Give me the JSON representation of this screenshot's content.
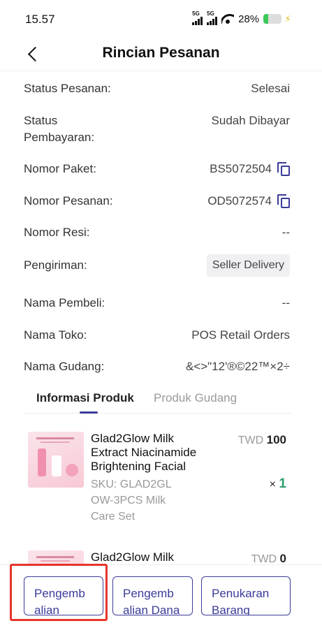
{
  "status_bar": {
    "time": "15.57",
    "signal1_label": "5G",
    "signal2_label": "5G",
    "battery_text": "28%",
    "battery_level": 0.28
  },
  "header": {
    "title": "Rincian Pesanan"
  },
  "details": {
    "status_pesanan": {
      "label": "Status Pesanan:",
      "value": "Selesai"
    },
    "status_pembayaran": {
      "label_line1": "Status",
      "label_line2": "Pembayaran:",
      "value": "Sudah Dibayar"
    },
    "nomor_paket": {
      "label": "Nomor Paket:",
      "value": "BS5072504"
    },
    "nomor_pesanan": {
      "label": "Nomor Pesanan:",
      "value": "OD5072574"
    },
    "nomor_resi": {
      "label": "Nomor Resi:",
      "value": "--"
    },
    "pengiriman": {
      "label": "Pengiriman:",
      "value": "Seller Delivery"
    },
    "nama_pembeli": {
      "label": "Nama Pembeli:",
      "value": "--"
    },
    "nama_toko": {
      "label": "Nama Toko:",
      "value": "POS Retail Orders"
    },
    "nama_gudang": {
      "label": "Nama Gudang:",
      "value": "&<>\"12'®©22™×2÷"
    }
  },
  "tabs": [
    {
      "label": "Informasi Produk",
      "active": true
    },
    {
      "label": "Produk Gudang",
      "active": false
    }
  ],
  "products": [
    {
      "name_line1": "Glad2Glow Milk",
      "name_line2": "Extract Niacinamide",
      "name_line3": "Brightening Facial",
      "sku_line1": "SKU: GLAD2GL",
      "sku_line2": "OW-3PCS Milk",
      "sku_line3": "Care Set",
      "currency": "TWD",
      "price": "100",
      "qty_prefix": "×",
      "qty": "1"
    },
    {
      "name_line1": "Glad2Glow Milk",
      "currency": "TWD",
      "price": "0"
    }
  ],
  "actions": {
    "btn1": {
      "line1": "Pengemb",
      "line2": "alian"
    },
    "btn2": {
      "line1": "Pengemb",
      "line2": "alian Dana"
    },
    "btn3": {
      "line1": "Penukaran",
      "line2": "Barang"
    }
  },
  "colors": {
    "accent": "#3b3b9a",
    "qty_green": "#2a9d6a",
    "highlight_red": "#e5352c"
  }
}
